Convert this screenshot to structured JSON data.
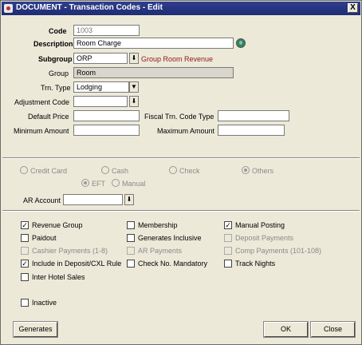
{
  "window": {
    "title": "DOCUMENT - Transaction Codes - Edit",
    "close_label": "X"
  },
  "form": {
    "code": {
      "label": "Code",
      "value": "1003"
    },
    "description": {
      "label": "Description",
      "value": "Room Charge"
    },
    "subgroup": {
      "label": "Subgroup",
      "value": "ORP",
      "description": "Group Room Revenue"
    },
    "group": {
      "label": "Group",
      "value": "Room"
    },
    "trn_type": {
      "label": "Trn. Type",
      "value": "Lodging"
    },
    "adjustment_code": {
      "label": "Adjustment Code",
      "value": ""
    },
    "default_price": {
      "label": "Default Price",
      "value": ""
    },
    "fiscal_trn_code_type": {
      "label": "Fiscal Trn. Code Type",
      "value": ""
    },
    "minimum_amount": {
      "label": "Minimum Amount",
      "value": ""
    },
    "maximum_amount": {
      "label": "Maximum Amount",
      "value": ""
    }
  },
  "payment_types": {
    "credit_card": "Credit Card",
    "cash": "Cash",
    "check": "Check",
    "others": "Others",
    "eft": "EFT",
    "manual": "Manual",
    "selected": [
      "others",
      "eft"
    ]
  },
  "ar_account": {
    "label": "AR Account",
    "value": ""
  },
  "options": {
    "revenue_group": {
      "label": "Revenue Group",
      "checked": true
    },
    "membership": {
      "label": "Membership",
      "checked": false
    },
    "manual_posting": {
      "label": "Manual Posting",
      "checked": true
    },
    "paidout": {
      "label": "Paidout",
      "checked": false
    },
    "generates_inclusive": {
      "label": "Generates Inclusive",
      "checked": false
    },
    "deposit_payments": {
      "label": "Deposit Payments",
      "checked": false
    },
    "cashier_payments": {
      "label": "Cashier Payments (1-8)",
      "checked": false
    },
    "ar_payments": {
      "label": "AR Payments",
      "checked": false
    },
    "comp_payments": {
      "label": "Comp Payments (101-108)",
      "checked": false
    },
    "include_deposit": {
      "label": "Include in Deposit/CXL Rule",
      "checked": true
    },
    "check_no_mandatory": {
      "label": "Check No. Mandatory",
      "checked": false
    },
    "track_nights": {
      "label": "Track Nights",
      "checked": false
    },
    "inter_hotel_sales": {
      "label": "Inter Hotel Sales",
      "checked": false
    },
    "inactive": {
      "label": "Inactive",
      "checked": false
    }
  },
  "buttons": {
    "generates": "Generates",
    "ok": "OK",
    "close": "Close"
  },
  "colors": {
    "subgroup_desc": "#8b1a1a",
    "titlebar": "#24327d",
    "window_bg": "#ece9d8"
  }
}
